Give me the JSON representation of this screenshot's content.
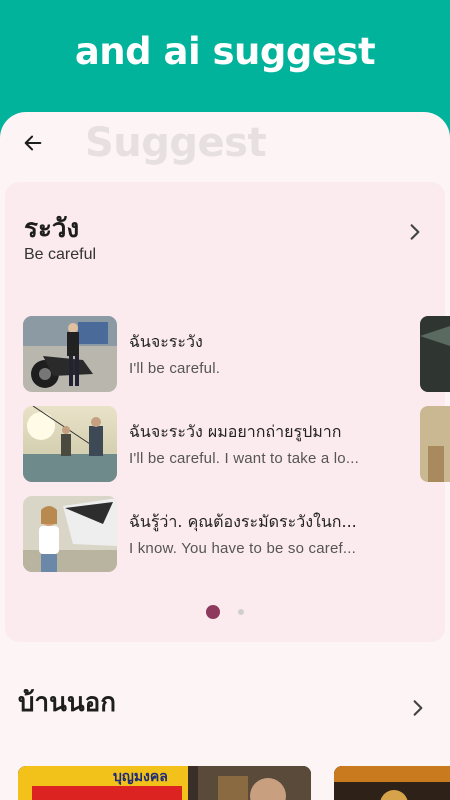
{
  "banner": {
    "title": "and ai suggest"
  },
  "header": {
    "title": "Suggest"
  },
  "card": {
    "word": "ระวัง",
    "translation": "Be careful",
    "examples": [
      {
        "thai": "ฉันจะระวัง",
        "english": "I'll be careful."
      },
      {
        "thai": "ฉันจะระวัง ผมอยากถ่ายรูปมาก",
        "english": "I'll be careful. I want to take a lo..."
      },
      {
        "thai": "ฉันรู้ว่า. คุณต้องระมัดระวังในก...",
        "english": "I know. You have to be so caref..."
      }
    ],
    "pager": {
      "pages": 2,
      "active": 1
    }
  },
  "section2": {
    "title": "บ้านนอก",
    "media_caption": "บุญมงคล"
  },
  "colors": {
    "accent": "#00b39a",
    "card_bg": "#fcebee",
    "pager_active": "#8e3a5e",
    "page_bg": "#fdf4f5"
  },
  "icons": {
    "back": "arrow-left-icon",
    "next": "chevron-right-icon"
  }
}
